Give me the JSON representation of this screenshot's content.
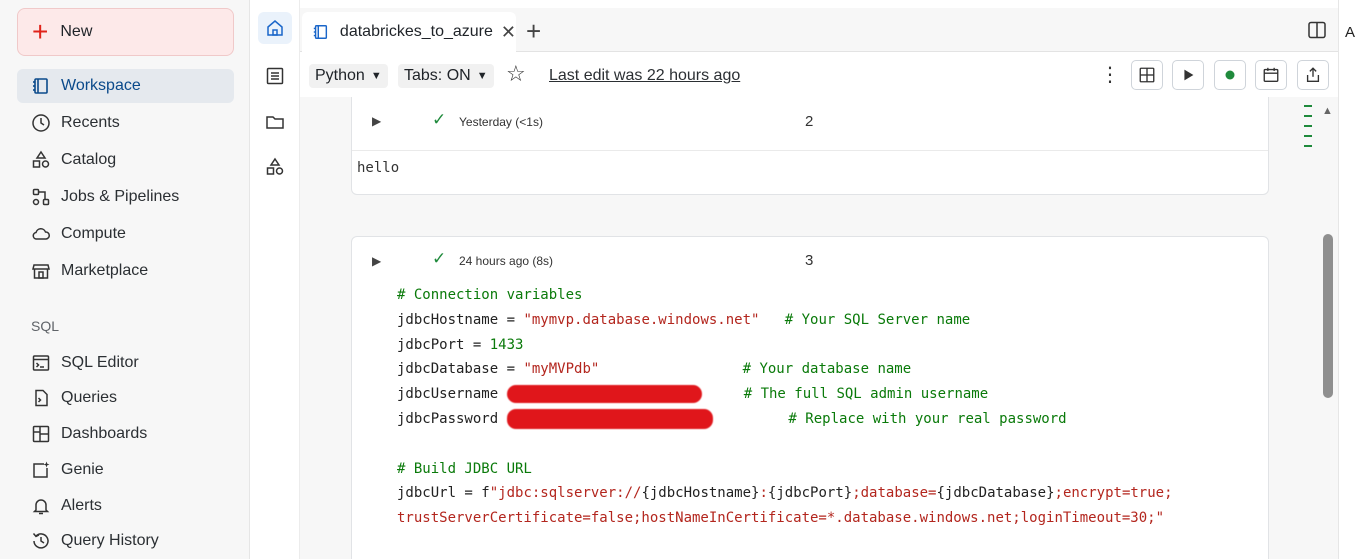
{
  "sidebar": {
    "new_label": "New",
    "items": [
      {
        "label": "Workspace",
        "icon": "workspace-icon"
      },
      {
        "label": "Recents",
        "icon": "clock-icon"
      },
      {
        "label": "Catalog",
        "icon": "catalog-icon"
      },
      {
        "label": "Jobs & Pipelines",
        "icon": "jobs-icon"
      },
      {
        "label": "Compute",
        "icon": "cloud-icon"
      },
      {
        "label": "Marketplace",
        "icon": "store-icon"
      }
    ],
    "sql_section_label": "SQL",
    "sql_items": [
      {
        "label": "SQL Editor",
        "icon": "sql-editor-icon"
      },
      {
        "label": "Queries",
        "icon": "queries-icon"
      },
      {
        "label": "Dashboards",
        "icon": "dashboard-icon"
      },
      {
        "label": "Genie",
        "icon": "genie-icon"
      },
      {
        "label": "Alerts",
        "icon": "bell-icon"
      },
      {
        "label": "Query History",
        "icon": "history-icon"
      }
    ]
  },
  "tabbar": {
    "tab_title": "databrickes_to_azure",
    "right_edge_letter": "A"
  },
  "toolbar": {
    "language": "Python",
    "tabs_setting": "Tabs: ON",
    "last_edit": "Last edit was 22 hours ago"
  },
  "cells": [
    {
      "number": "2",
      "status": "Yesterday (<1s)",
      "output": "hello"
    },
    {
      "number": "3",
      "status": "24 hours ago (8s)"
    }
  ],
  "code": {
    "line1": "# Connection variables",
    "host_var": "jdbcHostname = ",
    "host_val": "\"mymvp.database.windows.net\"",
    "host_comment": "   # Your SQL Server name",
    "port_var": "jdbcPort = ",
    "port_val": "1433",
    "db_var": "jdbcDatabase = ",
    "db_val": "\"myMVPdb\"",
    "db_comment": "                 # Your database name",
    "user_var": "jdbcUsername ",
    "user_comment": "     # The full SQL admin username",
    "pass_var": "jdbcPassword ",
    "pass_comment": "         # Replace with your real password",
    "build_comment": "# Build JDBC URL",
    "url_var": "jdbcUrl = ",
    "url_f": "f",
    "url_part1": "\"jdbc:sqlserver://",
    "url_host": "{jdbcHostname}",
    "url_colon": ":",
    "url_port": "{jdbcPort}",
    "url_part2": ";database=",
    "url_db": "{jdbcDatabase}",
    "url_part3": ";encrypt=true;",
    "url_line2": "trustServerCertificate=false;hostNameInCertificate=*.database.windows.net;loginTimeout=30;\""
  }
}
